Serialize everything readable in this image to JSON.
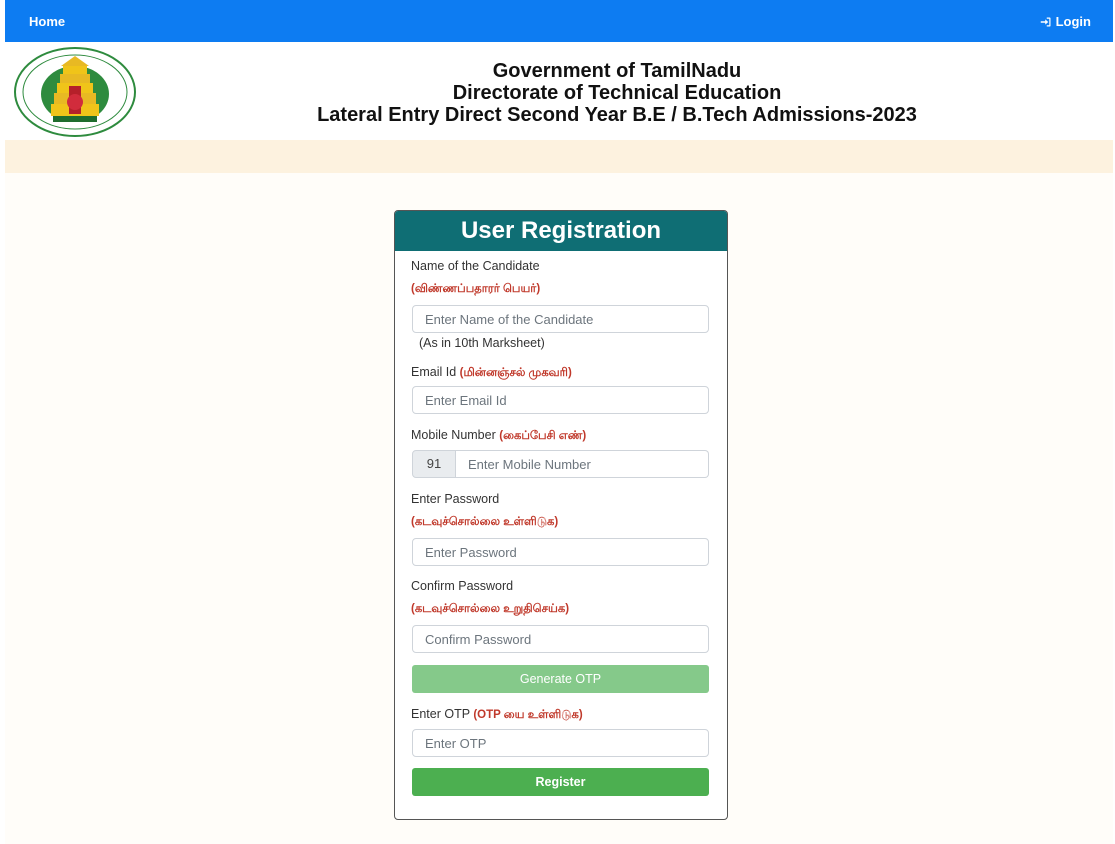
{
  "nav": {
    "home_label": "Home",
    "login_label": "Login",
    "login_icon": "sign-in-icon",
    "bar_color": "#0d7cf2"
  },
  "header": {
    "line1": "Government of TamilNadu",
    "line2": "Directorate of Technical Education",
    "line3": "Lateral Entry Direct Second Year B.E / B.Tech Admissions-2023",
    "emblem": "tamilnadu-emblem"
  },
  "form": {
    "title": "User Registration",
    "header_color": "#0f6e74",
    "name": {
      "label": "Name of the Candidate",
      "label_tamil": "(விண்ணப்பதாரர் பெயர்)",
      "placeholder": "Enter Name of the Candidate",
      "hint": "(As in 10th Marksheet)"
    },
    "email": {
      "label": "Email Id",
      "label_tamil": "(மின்னஞ்சல் முகவரி)",
      "placeholder": "Enter Email Id"
    },
    "mobile": {
      "label": "Mobile Number",
      "label_tamil": "(கைப்பேசி எண்)",
      "prefix": "91",
      "placeholder": "Enter Mobile Number"
    },
    "password": {
      "label": "Enter Password",
      "label_tamil": "(கடவுச்சொல்லை உள்ளிடுக)",
      "placeholder": "Enter Password"
    },
    "confirm": {
      "label": "Confirm Password",
      "label_tamil": "(கடவுச்சொல்லை உறுதிசெய்க)",
      "placeholder": "Confirm Password"
    },
    "generate_otp_label": "Generate OTP",
    "otp": {
      "label": "Enter OTP",
      "label_tamil": "(OTP யை உள்ளிடுக)",
      "placeholder": "Enter OTP"
    },
    "register_label": "Register"
  }
}
